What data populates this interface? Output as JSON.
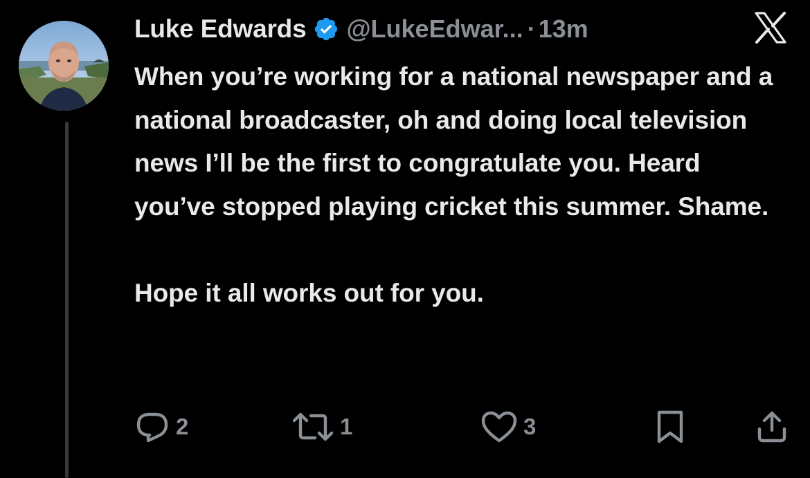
{
  "author": {
    "name": "Luke Edwards",
    "handle": "@LukeEdwar...",
    "separator": "·",
    "time": "13m",
    "verified": true,
    "avatar": "profile-photo"
  },
  "tweet": {
    "paragraphs": [
      "When you’re working for a national newspaper and a national broadcaster, oh and doing local television news I’ll be the first to congratulate you. Heard you’ve stopped playing cricket this summer. Shame.",
      "Hope it all works out for you."
    ]
  },
  "actions": {
    "replies": "2",
    "reposts": "1",
    "likes": "3"
  },
  "icons": {
    "verified": "verified-badge-icon",
    "logo": "x-logo-icon",
    "reply": "reply-icon",
    "repost": "repost-icon",
    "like": "heart-icon",
    "bookmark": "bookmark-icon",
    "share": "share-icon"
  },
  "colors": {
    "background": "#000000",
    "text": "#e7e9ea",
    "secondary": "#8b9096",
    "verified": "#1d9bf0"
  }
}
